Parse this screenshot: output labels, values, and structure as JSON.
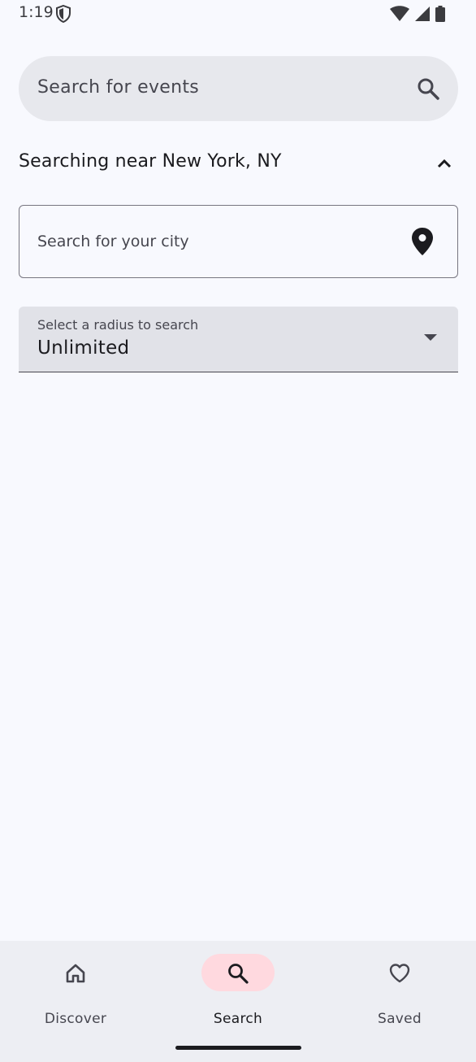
{
  "status_bar": {
    "time": "1:19"
  },
  "search": {
    "placeholder": "Search for events"
  },
  "location": {
    "searching_near": "Searching near New York, NY"
  },
  "city_field": {
    "placeholder": "Search for your city"
  },
  "radius": {
    "label": "Select a radius to search",
    "value": "Unlimited"
  },
  "nav": {
    "items": [
      {
        "label": "Discover",
        "icon": "home-icon",
        "active": false
      },
      {
        "label": "Search",
        "icon": "search-icon",
        "active": true
      },
      {
        "label": "Saved",
        "icon": "heart-icon",
        "active": false
      }
    ]
  },
  "colors": {
    "background": "#f8f9fe",
    "search_bar": "#e7e8ed",
    "active_nav_pill": "#ffd9df",
    "nav_bar": "#edeef3"
  }
}
